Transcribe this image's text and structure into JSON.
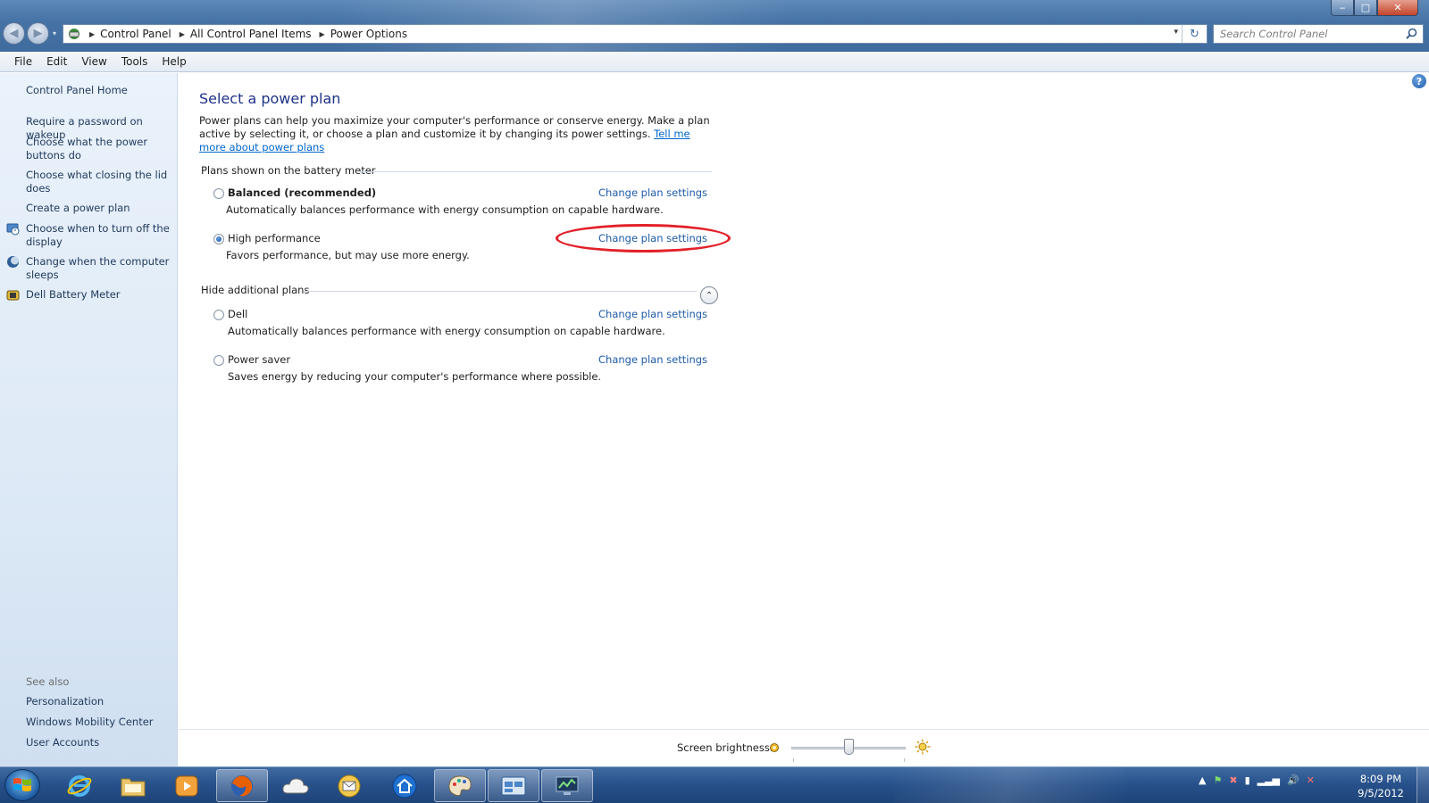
{
  "window": {
    "controls": {
      "minimize": "‒",
      "maximize": "□",
      "close": "✕"
    }
  },
  "nav": {
    "back": "◀",
    "forward": "▶",
    "dropdown": "▾"
  },
  "address": {
    "crumbs": [
      "Control Panel",
      "All Control Panel Items",
      "Power Options"
    ],
    "separator": "▶",
    "dropdown": "▾",
    "refresh": "↻"
  },
  "search": {
    "placeholder": "Search Control Panel"
  },
  "menu": [
    "File",
    "Edit",
    "View",
    "Tools",
    "Help"
  ],
  "sidebar": {
    "home": "Control Panel Home",
    "links": [
      "Require a password on wakeup",
      "Choose what the power buttons do",
      "Choose what closing the lid does",
      "Create a power plan",
      "Choose when to turn off the display",
      "Change when the computer sleeps",
      "Dell Battery Meter"
    ],
    "see_also_title": "See also",
    "see_also": [
      "Personalization",
      "Windows Mobility Center",
      "User Accounts"
    ]
  },
  "main": {
    "help": "?",
    "title": "Select a power plan",
    "intro": "Power plans can help you maximize your computer's performance or conserve energy. Make a plan active by selecting it, or choose a plan and customize it by changing its power settings. ",
    "intro_link": "Tell me more about power plans",
    "group1_title": "Plans shown on the battery meter",
    "group2_title": "Hide additional plans",
    "collapse": "⌃",
    "plans": [
      {
        "name": "Balanced (recommended)",
        "description": "Automatically balances performance with energy consumption on capable hardware.",
        "link": "Change plan settings",
        "selected": false
      },
      {
        "name": "High performance",
        "description": "Favors performance, but may use more energy.",
        "link": "Change plan settings",
        "selected": true
      },
      {
        "name": "Dell",
        "description": "Automatically balances performance with energy consumption on capable hardware.",
        "link": "Change plan settings",
        "selected": false
      },
      {
        "name": "Power saver",
        "description": "Saves energy by reducing your computer's performance where possible.",
        "link": "Change plan settings",
        "selected": false
      }
    ]
  },
  "brightness": {
    "label": "Screen brightness:",
    "level": 0.5
  },
  "taskbar": {
    "tray": [
      "▲",
      "⚑",
      "✖",
      "▮",
      "▂▃▅",
      "🔊",
      "✕"
    ],
    "time": "8:09 PM",
    "date": "9/5/2012"
  },
  "colors": {
    "link": "#1e5aa8",
    "title": "#1e3287",
    "annotation": "#e32028",
    "taskbar": "#27508a"
  }
}
